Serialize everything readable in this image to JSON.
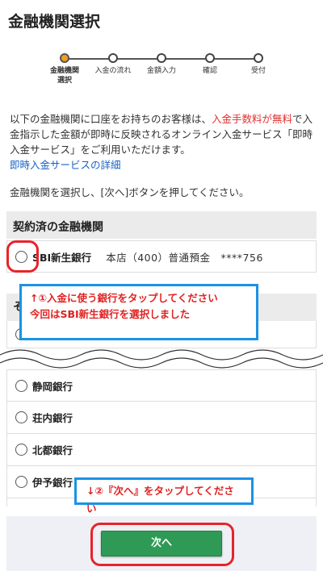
{
  "page": {
    "title": "金融機関選択"
  },
  "stepper": {
    "steps": [
      {
        "label": "金融機関選択",
        "active": true
      },
      {
        "label": "入金の流れ",
        "active": false
      },
      {
        "label": "金額入力",
        "active": false
      },
      {
        "label": "確認",
        "active": false
      },
      {
        "label": "受付",
        "active": false
      }
    ],
    "active_color": "#f0a01e"
  },
  "intro": {
    "text_before": "以下の金融機関に口座をお持ちのお客様は、",
    "highlight": "入金手数料が無料",
    "text_after": "で入金指示した金額が即時に反映されるオンライン入金サービス「即時入金サービス」をご利用いただけます。",
    "link": "即時入金サービスの詳細"
  },
  "instruction": "金融機関を選択し、[次へ]ボタンを押してください。",
  "contracted": {
    "header": "契約済の金融機関",
    "bank": {
      "name": "SBI新生銀行",
      "detail": "本店（400）普通預金　****756"
    }
  },
  "others": {
    "header_visible": "そ",
    "banks": [
      "静岡銀行",
      "荘内銀行",
      "北都銀行",
      "伊予銀行"
    ]
  },
  "next_button": {
    "label": "次へ",
    "color": "#2f9a55"
  },
  "annotations": {
    "callout1_line1": "↑①入金に使う銀行をタップしてください",
    "callout1_line2": "今回はSBI新生銀行を選択しました",
    "callout2": "↓②『次へ』をタップしてください",
    "ring_color": "#e8232a",
    "callout_border": "#1a92e6"
  }
}
